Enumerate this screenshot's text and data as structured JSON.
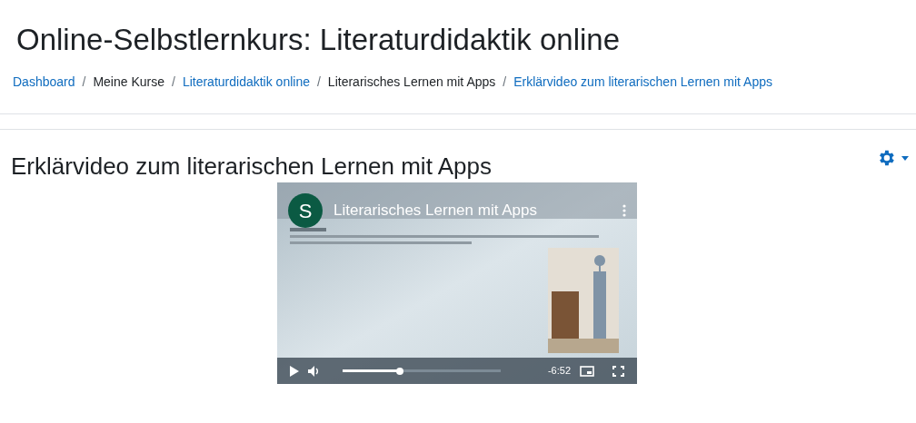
{
  "page_title": "Online-Selbstlernkurs: Literaturdidaktik online",
  "breadcrumb": [
    {
      "label": "Dashboard",
      "link": true
    },
    {
      "label": "Meine Kurse",
      "link": false
    },
    {
      "label": "Literaturdidaktik online",
      "link": true
    },
    {
      "label": "Literarisches Lernen mit Apps",
      "link": false
    },
    {
      "label": "Erklärvideo zum literarischen Lernen mit Apps",
      "link": true
    }
  ],
  "separator": "/",
  "activity_title": "Erklärvideo zum literarischen Lernen mit Apps",
  "video": {
    "channel_initial": "S",
    "title": "Literarisches Lernen mit Apps",
    "time": "-6:52",
    "progress": {
      "level": 0.36
    }
  }
}
